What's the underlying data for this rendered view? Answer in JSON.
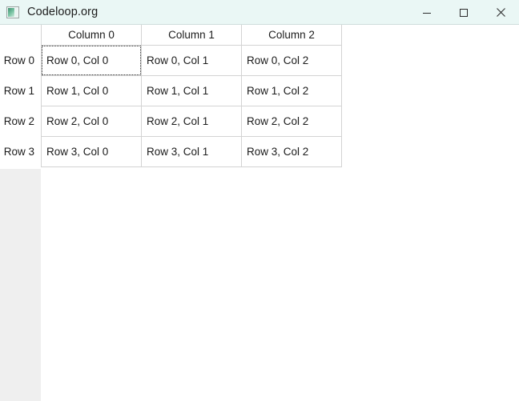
{
  "window": {
    "title": "Codeloop.org",
    "icon": "app-logo-icon",
    "titlebar_color": "#eaf7f5",
    "controls": [
      {
        "name": "minimize",
        "glyph": "minimize-icon"
      },
      {
        "name": "maximize",
        "glyph": "maximize-icon"
      },
      {
        "name": "close",
        "glyph": "close-icon"
      }
    ]
  },
  "table": {
    "corner_label": "",
    "column_headers": [
      "Column 0",
      "Column 1",
      "Column 2"
    ],
    "row_headers": [
      "Row 0",
      "Row 1",
      "Row 2",
      "Row 3"
    ],
    "focused_cell": {
      "row": 0,
      "col": 0
    },
    "grid_color": "#d3d3d3",
    "rows": [
      [
        "Row 0, Col 0",
        "Row 0, Col 1",
        "Row 0, Col 2"
      ],
      [
        "Row 1, Col 0",
        "Row 1, Col 1",
        "Row 1, Col 2"
      ],
      [
        "Row 2, Col 0",
        "Row 2, Col 1",
        "Row 2, Col 2"
      ],
      [
        "Row 3, Col 0",
        "Row 3, Col 1",
        "Row 3, Col 2"
      ]
    ]
  }
}
